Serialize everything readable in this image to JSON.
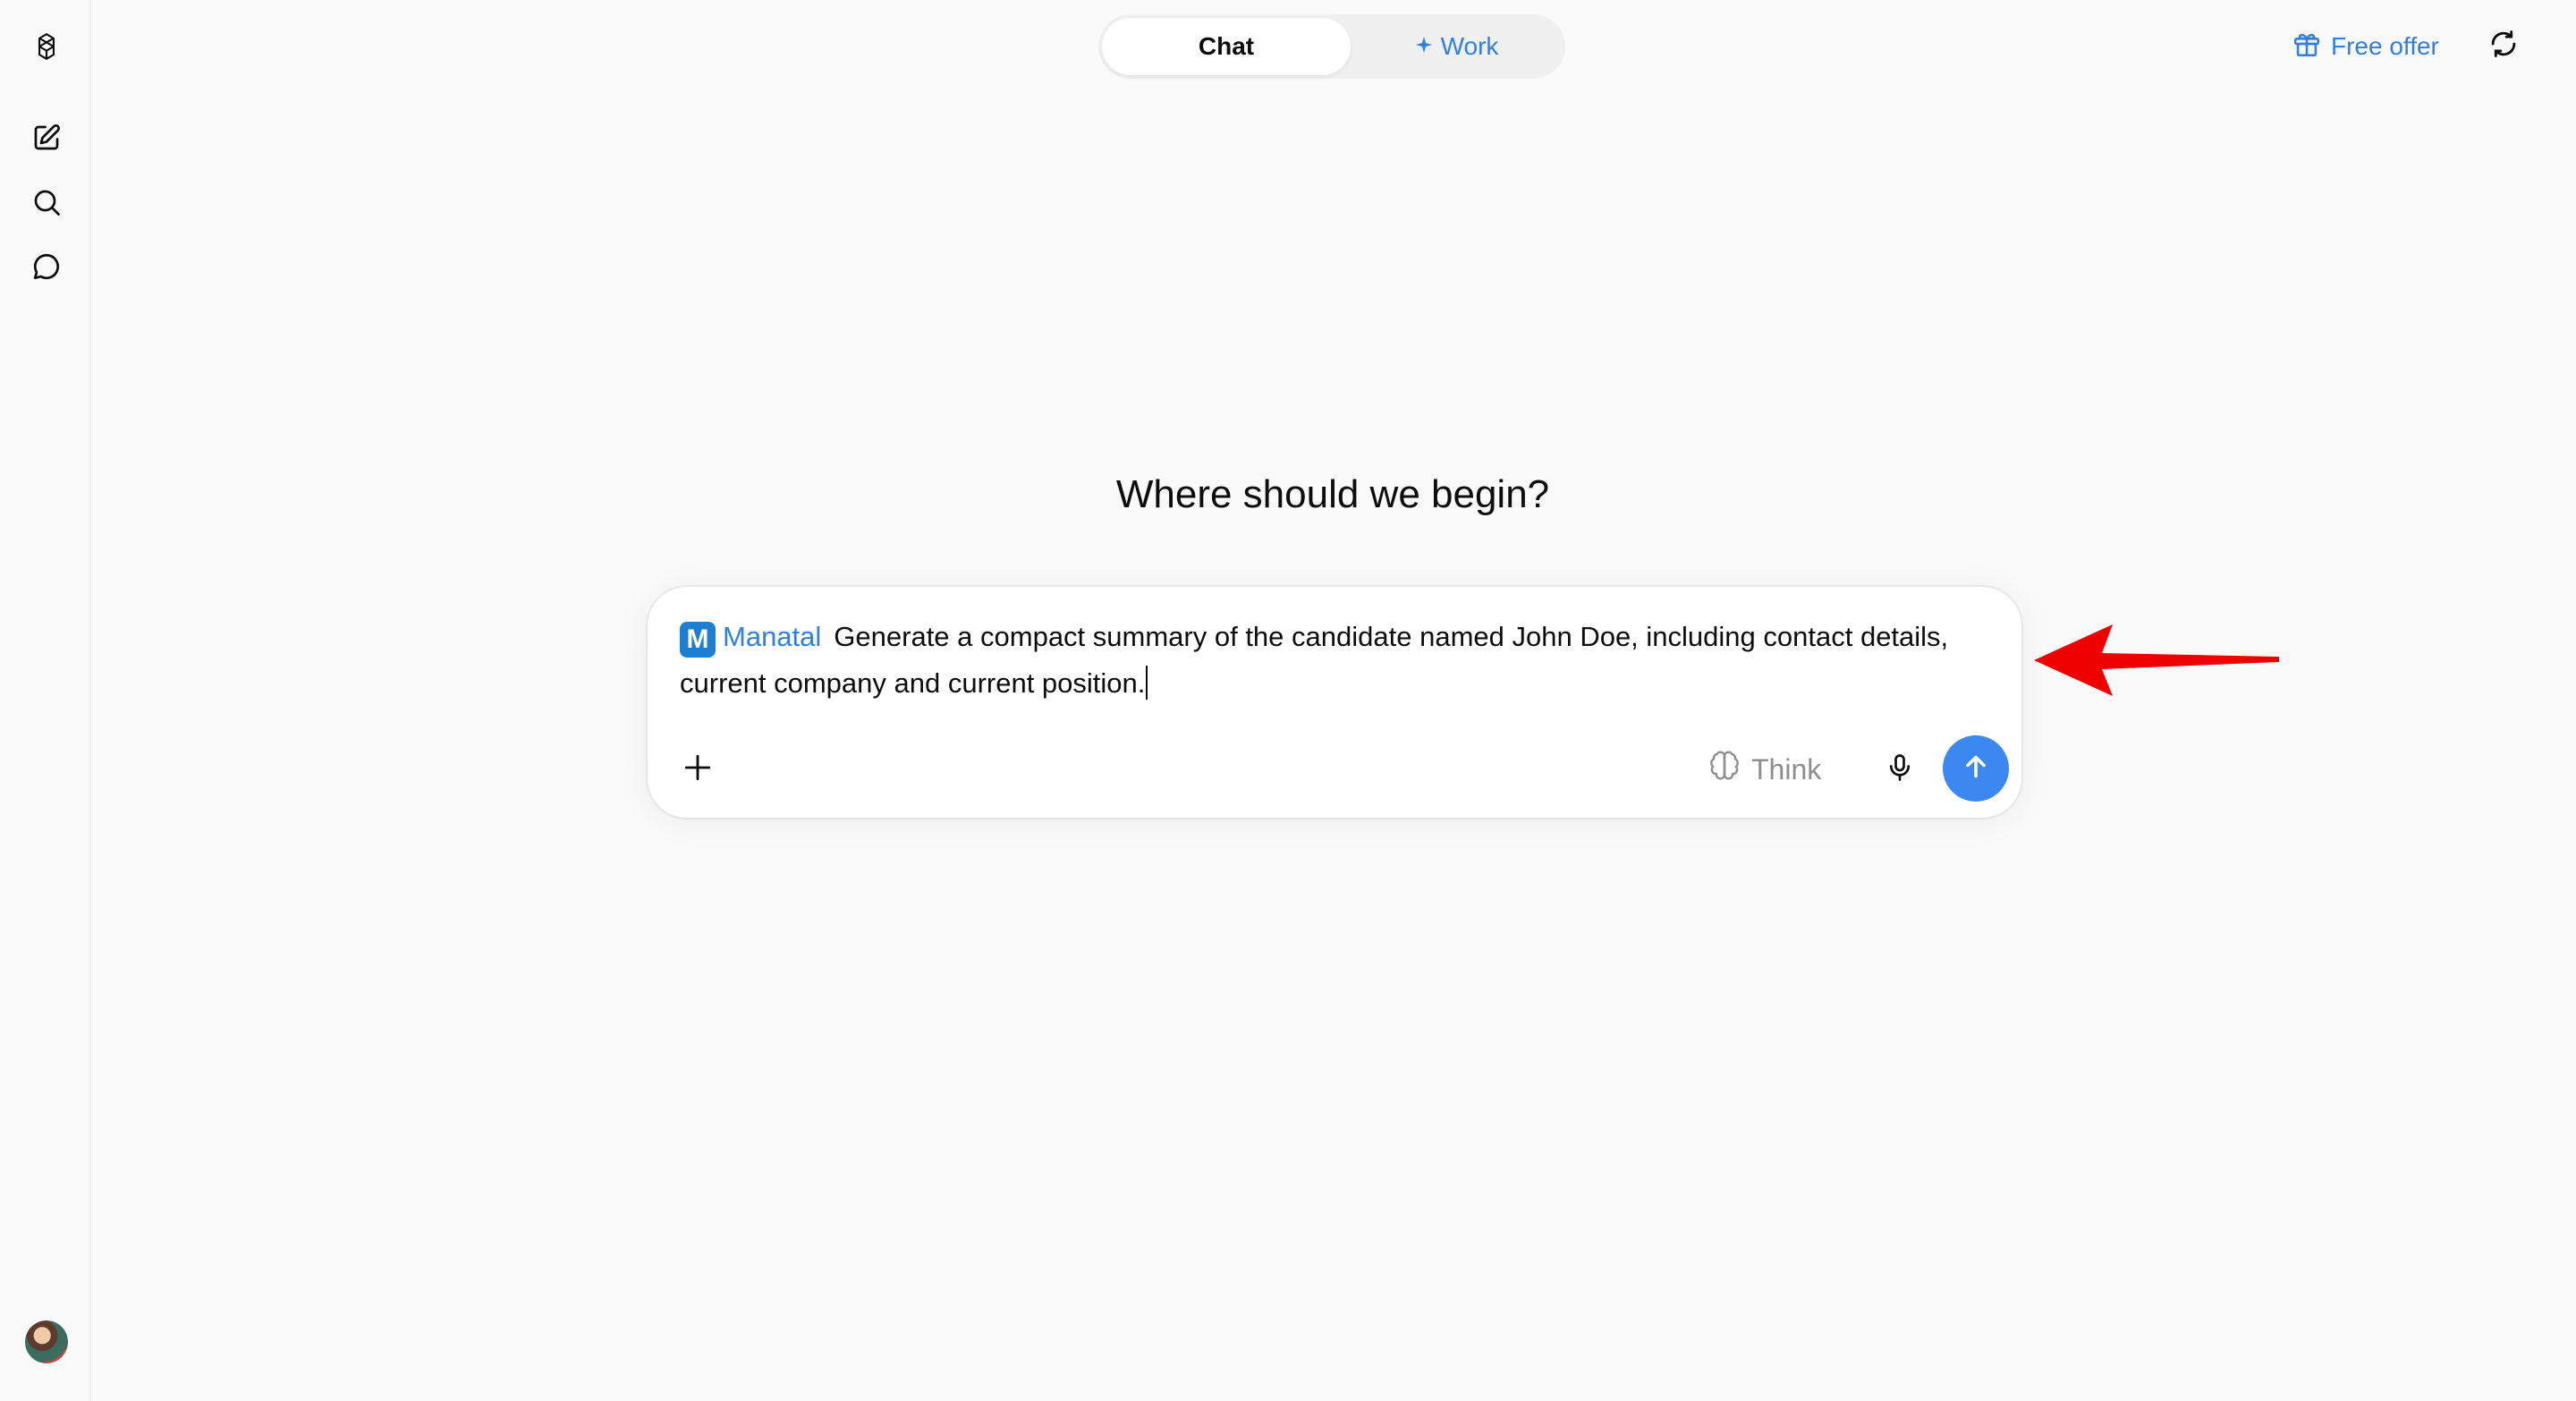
{
  "sidebar": {
    "logo_icon": "openai-logo-icon",
    "items": [
      {
        "icon": "new-chat-icon"
      },
      {
        "icon": "search-icon"
      },
      {
        "icon": "chat-bubble-icon"
      }
    ],
    "avatar_icon": "user-avatar"
  },
  "header": {
    "modes": {
      "chat_label": "Chat",
      "work_label": "Work",
      "work_icon": "sparkle-icon"
    },
    "free_offer_label": "Free offer",
    "free_offer_icon": "gift-icon",
    "refresh_icon": "refresh-icon"
  },
  "main": {
    "headline": "Where should we begin?"
  },
  "composer": {
    "app_chip_letter": "M",
    "app_chip_name": "Manatal",
    "prompt_text": "Generate a compact summary of the candidate named John Doe, including contact details, current company and current position.",
    "think_label": "Think",
    "plus_icon": "plus-icon",
    "think_icon": "brain-icon",
    "mic_icon": "microphone-icon",
    "send_icon": "arrow-up-icon"
  },
  "colors": {
    "accent": "#2f7fe6",
    "send_button": "#3b88f0",
    "annotation_arrow": "#ee0000",
    "background": "#fafafa"
  }
}
